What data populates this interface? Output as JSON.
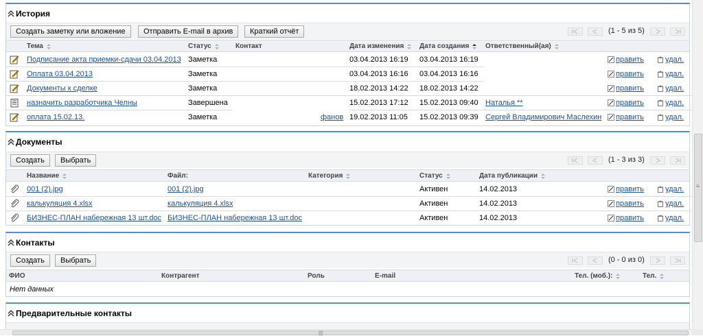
{
  "history": {
    "title": "История",
    "buttons": [
      "Создать заметку или вложение",
      "Отправить E-mail в архив",
      "Краткий отчёт"
    ],
    "pager": "(1 - 5 из 5)",
    "columns": [
      "Тема",
      "Статус",
      "Контакт",
      "Дата изменения",
      "Дата создания",
      "Ответственный(ая)"
    ],
    "rows": [
      {
        "icon": "note-edit-icon",
        "subject": "Подписание акта приемки-сдачи 03.04.2013",
        "status": "Заметка",
        "contact": "",
        "modified": "03.04.2013 16:19",
        "created": "03.04.2013 16:19",
        "owner": "",
        "edit": "править",
        "del": "удал."
      },
      {
        "icon": "note-edit-icon",
        "subject": "Оплата 03.04.2013",
        "status": "Заметка",
        "contact": "",
        "modified": "03.04.2013 16:16",
        "created": "03.04.2013 16:16",
        "owner": "",
        "edit": "править",
        "del": "удал."
      },
      {
        "icon": "note-edit-icon",
        "subject": "Документы к сделке",
        "status": "Заметка",
        "contact": "",
        "modified": "18.02.2013 14:22",
        "created": "18.02.2013 14:22",
        "owner": "",
        "edit": "править",
        "del": "удал."
      },
      {
        "icon": "task-list-icon",
        "subject": "назначить разработчика Челны",
        "status": "Завершена",
        "contact": "",
        "modified": "15.02.2013 17:12",
        "created": "15.02.2013 09:40",
        "owner": "Наталья **",
        "edit": "править",
        "del": "удал."
      },
      {
        "icon": "note-edit-icon",
        "subject": "оплата 15.02.13.",
        "status": "Заметка",
        "contact": "фанов",
        "modified": "19.02.2013 11:05",
        "created": "15.02.2013 09:39",
        "owner": "Сергей Владимирович Маслехин",
        "edit": "править",
        "del": "удал."
      }
    ]
  },
  "documents": {
    "title": "Документы",
    "buttons": [
      "Создать",
      "Выбрать"
    ],
    "pager": "(1 - 3 из 3)",
    "columns": [
      "Название",
      "Файл:",
      "Категория",
      "Статус",
      "Дата публикации"
    ],
    "rows": [
      {
        "name": "001 (2).jpg",
        "file": "001 (2).jpg",
        "category": "",
        "status": "Активен",
        "published": "14.02.2013",
        "edit": "править",
        "del": "удал."
      },
      {
        "name": "калькуляция 4.xlsx",
        "file": "калькуляция 4.xlsx",
        "category": "",
        "status": "Активен",
        "published": "14.02.2013",
        "edit": "править",
        "del": "удал."
      },
      {
        "name": "БИЗНЕС-ПЛАН набережная 13 шт.doc",
        "file": "БИЗНЕС-ПЛАН набережная 13 шт.doc",
        "category": "",
        "status": "Активен",
        "published": "14.02.2013",
        "edit": "править",
        "del": "удал."
      }
    ]
  },
  "contacts": {
    "title": "Контакты",
    "buttons": [
      "Создать",
      "Выбрать"
    ],
    "pager": "(0 - 0 из 0)",
    "columns": [
      "ФИО",
      "Контрагент",
      "Роль",
      "E-mail",
      "Тел. (моб.):",
      "Тел."
    ],
    "empty": "Нет данных"
  },
  "pre_contacts": {
    "title": "Предварительные контакты"
  },
  "colors": {
    "accent_border": "#4f8ed0",
    "link": "#1a4f9c",
    "header_bg": "#eef0f3",
    "toolbar_bg": "#f3f4f6"
  }
}
